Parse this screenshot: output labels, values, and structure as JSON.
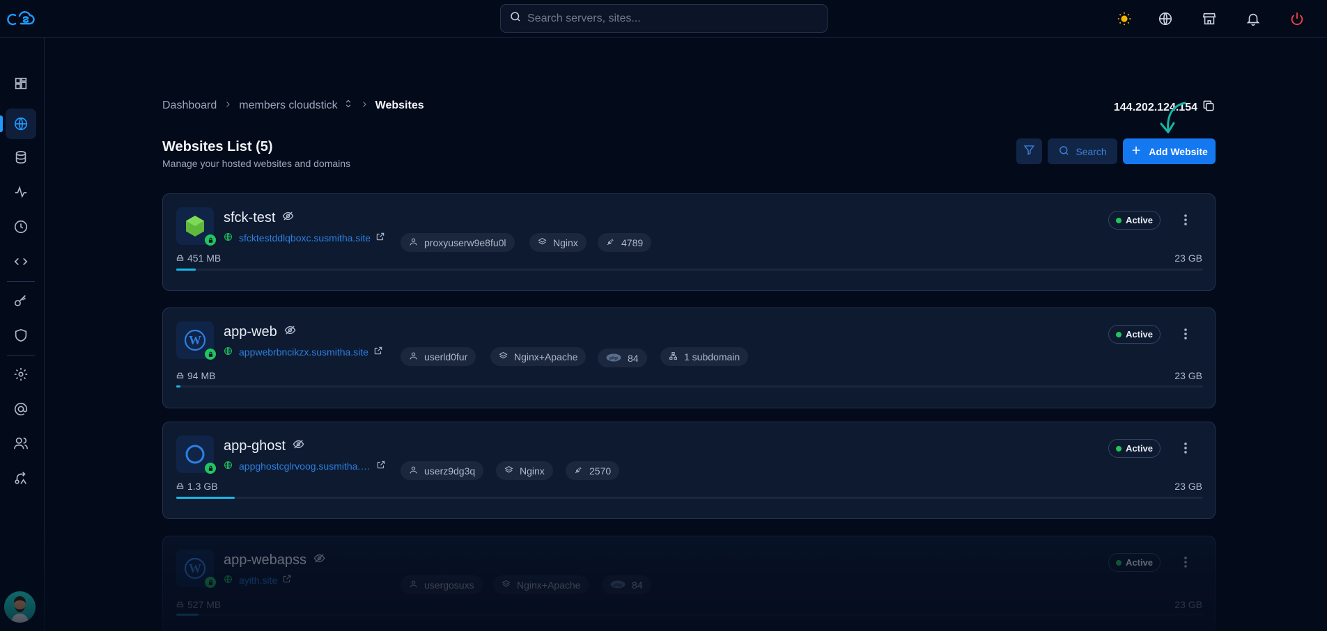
{
  "header": {
    "search_placeholder": "Search servers, sites...",
    "icons": [
      "logo-icon",
      "sun-icon",
      "globe-icon",
      "store-icon",
      "bell-icon",
      "power-icon"
    ]
  },
  "sidebar": {
    "items": [
      "dashboard-icon",
      "websites-icon",
      "database-icon",
      "activity-icon",
      "clock-icon",
      "code-icon",
      "key-icon",
      "shield-icon",
      "settings-icon",
      "email-icon",
      "users-icon",
      "route-icon"
    ],
    "active_index": 1
  },
  "breadcrumb": {
    "items": [
      "Dashboard",
      "members cloudstick",
      "Websites"
    ]
  },
  "server_ip": "144.202.124.154",
  "page": {
    "title": "Websites List (5)",
    "subtitle": "Manage your hosted websites and domains"
  },
  "toolbar": {
    "search_label": "Search",
    "add_label": "Add Website"
  },
  "colors": {
    "accent": "#1478f0",
    "active_status": "#22c55e",
    "progress": "#17b8e6"
  },
  "websites": [
    {
      "name": "sfck-test",
      "logo": "nodejs-icon",
      "domain": "sfcktestddlqboxc.susmitha.site",
      "user": "proxyuserw9e8fu0l",
      "stack": "Nginx",
      "extra_type": "port",
      "extra": "4789",
      "subdomains": "",
      "size": "451 MB",
      "total": "23 GB",
      "usage_fraction": 0.019,
      "status": "Active"
    },
    {
      "name": "app-web",
      "logo": "wordpress-icon",
      "domain": "appwebrbncikzx.susmitha.site",
      "user": "userld0fur",
      "stack": "Nginx+Apache",
      "extra_type": "php",
      "extra": "84",
      "subdomains": "1 subdomain",
      "size": "94 MB",
      "total": "23 GB",
      "usage_fraction": 0.004,
      "status": "Active"
    },
    {
      "name": "app-ghost",
      "logo": "ghost-icon",
      "domain": "appghostcglrvoog.susmitha.s...",
      "user": "userz9dg3q",
      "stack": "Nginx",
      "extra_type": "port",
      "extra": "2570",
      "subdomains": "",
      "size": "1.3 GB",
      "total": "23 GB",
      "usage_fraction": 0.057,
      "status": "Active"
    },
    {
      "name": "app-webapss",
      "logo": "wordpress-icon",
      "domain": "ayith.site",
      "user": "usergosuxs",
      "stack": "Nginx+Apache",
      "extra_type": "php",
      "extra": "84",
      "subdomains": "",
      "size": "527 MB",
      "total": "23 GB",
      "usage_fraction": 0.022,
      "status": "Active"
    }
  ]
}
